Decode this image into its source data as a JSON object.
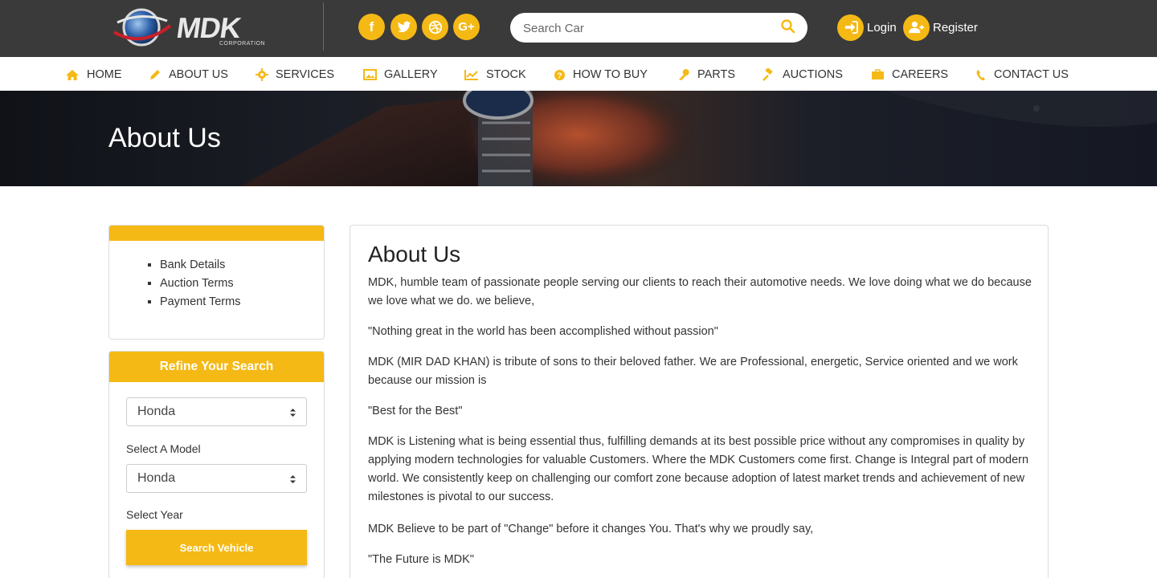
{
  "brand": {
    "name": "MDK",
    "tagline": "CORPORATION"
  },
  "header": {
    "social": [
      {
        "icon": "facebook-icon",
        "glyph": "f"
      },
      {
        "icon": "twitter-icon",
        "glyph": "t"
      },
      {
        "icon": "dribbble-icon",
        "glyph": "d"
      },
      {
        "icon": "google-plus-icon",
        "glyph": "G+"
      }
    ],
    "search": {
      "placeholder": "Search Car"
    },
    "login_label": "Login",
    "register_label": "Register"
  },
  "nav": {
    "items": [
      {
        "label": "HOME",
        "icon": "home-icon"
      },
      {
        "label": "ABOUT US",
        "icon": "pencil-icon"
      },
      {
        "label": "SERVICES",
        "icon": "gear-icon"
      },
      {
        "label": "GALLERY",
        "icon": "image-icon"
      },
      {
        "label": "STOCK",
        "icon": "chart-icon"
      },
      {
        "label": "HOW TO BUY",
        "icon": "question-icon"
      },
      {
        "label": "PARTS",
        "icon": "wrench-icon"
      },
      {
        "label": "AUCTIONS",
        "icon": "gavel-icon"
      },
      {
        "label": "CAREERS",
        "icon": "briefcase-icon"
      },
      {
        "label": "CONTACT US",
        "icon": "phone-icon"
      }
    ]
  },
  "banner": {
    "title": "About Us"
  },
  "sidebar": {
    "links": [
      "Bank Details",
      "Auction Terms",
      "Payment Terms"
    ],
    "refine": {
      "title": "Refine Your Search",
      "make_value": "Honda",
      "model_label": "Select A Model",
      "model_value": "Honda",
      "year_label": "Select Year",
      "button_label": "Search Vehicle"
    }
  },
  "main": {
    "title": "About Us",
    "paragraphs": [
      "MDK, humble team of passionate people serving our clients to reach their automotive needs. We love doing what we do because we love what we do. we believe,",
      "\"Nothing great in the world has been accomplished without passion\"",
      "MDK (MIR DAD KHAN) is tribute of sons to their beloved father. We are Professional, energetic, Service oriented and we work because our mission is",
      "\"Best for the Best\"",
      "MDK is Listening what is being essential thus, fulfilling demands at its best possible price without any compromises in quality by applying modern technologies for valuable Customers. Where the MDK Customers come first. Change is Integral part of modern world. We consistently keep on challenging our comfort zone because adoption of latest market trends and achievement of new milestones is pivotal to our success.",
      "MDK Believe to be part of \"Change\" before it changes You. That's why we proudly say,",
      "\"The Future is MDK\""
    ]
  },
  "colors": {
    "accent": "#f5b915",
    "topbar": "#3a3a3a"
  }
}
